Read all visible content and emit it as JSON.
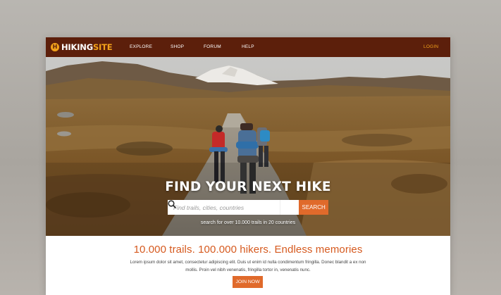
{
  "nav": {
    "logo_part1": "HIKING",
    "logo_part2": "SITE",
    "logo_letter": "H",
    "items": [
      {
        "label": "EXPLORE"
      },
      {
        "label": "SHOP"
      },
      {
        "label": "FORUM"
      },
      {
        "label": "HELP"
      }
    ],
    "login_label": "LOGIN"
  },
  "hero": {
    "title": "FIND YOUR NEXT HIKE",
    "search_placeholder": "Find trails, cities, countries",
    "search_button": "SEARCH",
    "subtitle": "search for over 10.000 trails in 20 countries"
  },
  "content": {
    "headline": "10.000 trails. 100.000 hikers. Endless memories",
    "body": "Lorem ipsum dolor sit amet, consectetur adipiscing elit. Duis ut enim id nulla condimentum fringilla. Donec blandit a ex non mollis. Proin vel nibh venenatis, fringilla tortor in, venenatis nunc.",
    "join_label": "JOIN NOW"
  },
  "colors": {
    "nav_bg": "#5c1f0b",
    "accent_orange": "#e06a2b",
    "logo_yellow": "#f2a21b",
    "headline": "#d65a1f"
  },
  "icons": [
    "hiking-logo-icon",
    "search-icon"
  ]
}
